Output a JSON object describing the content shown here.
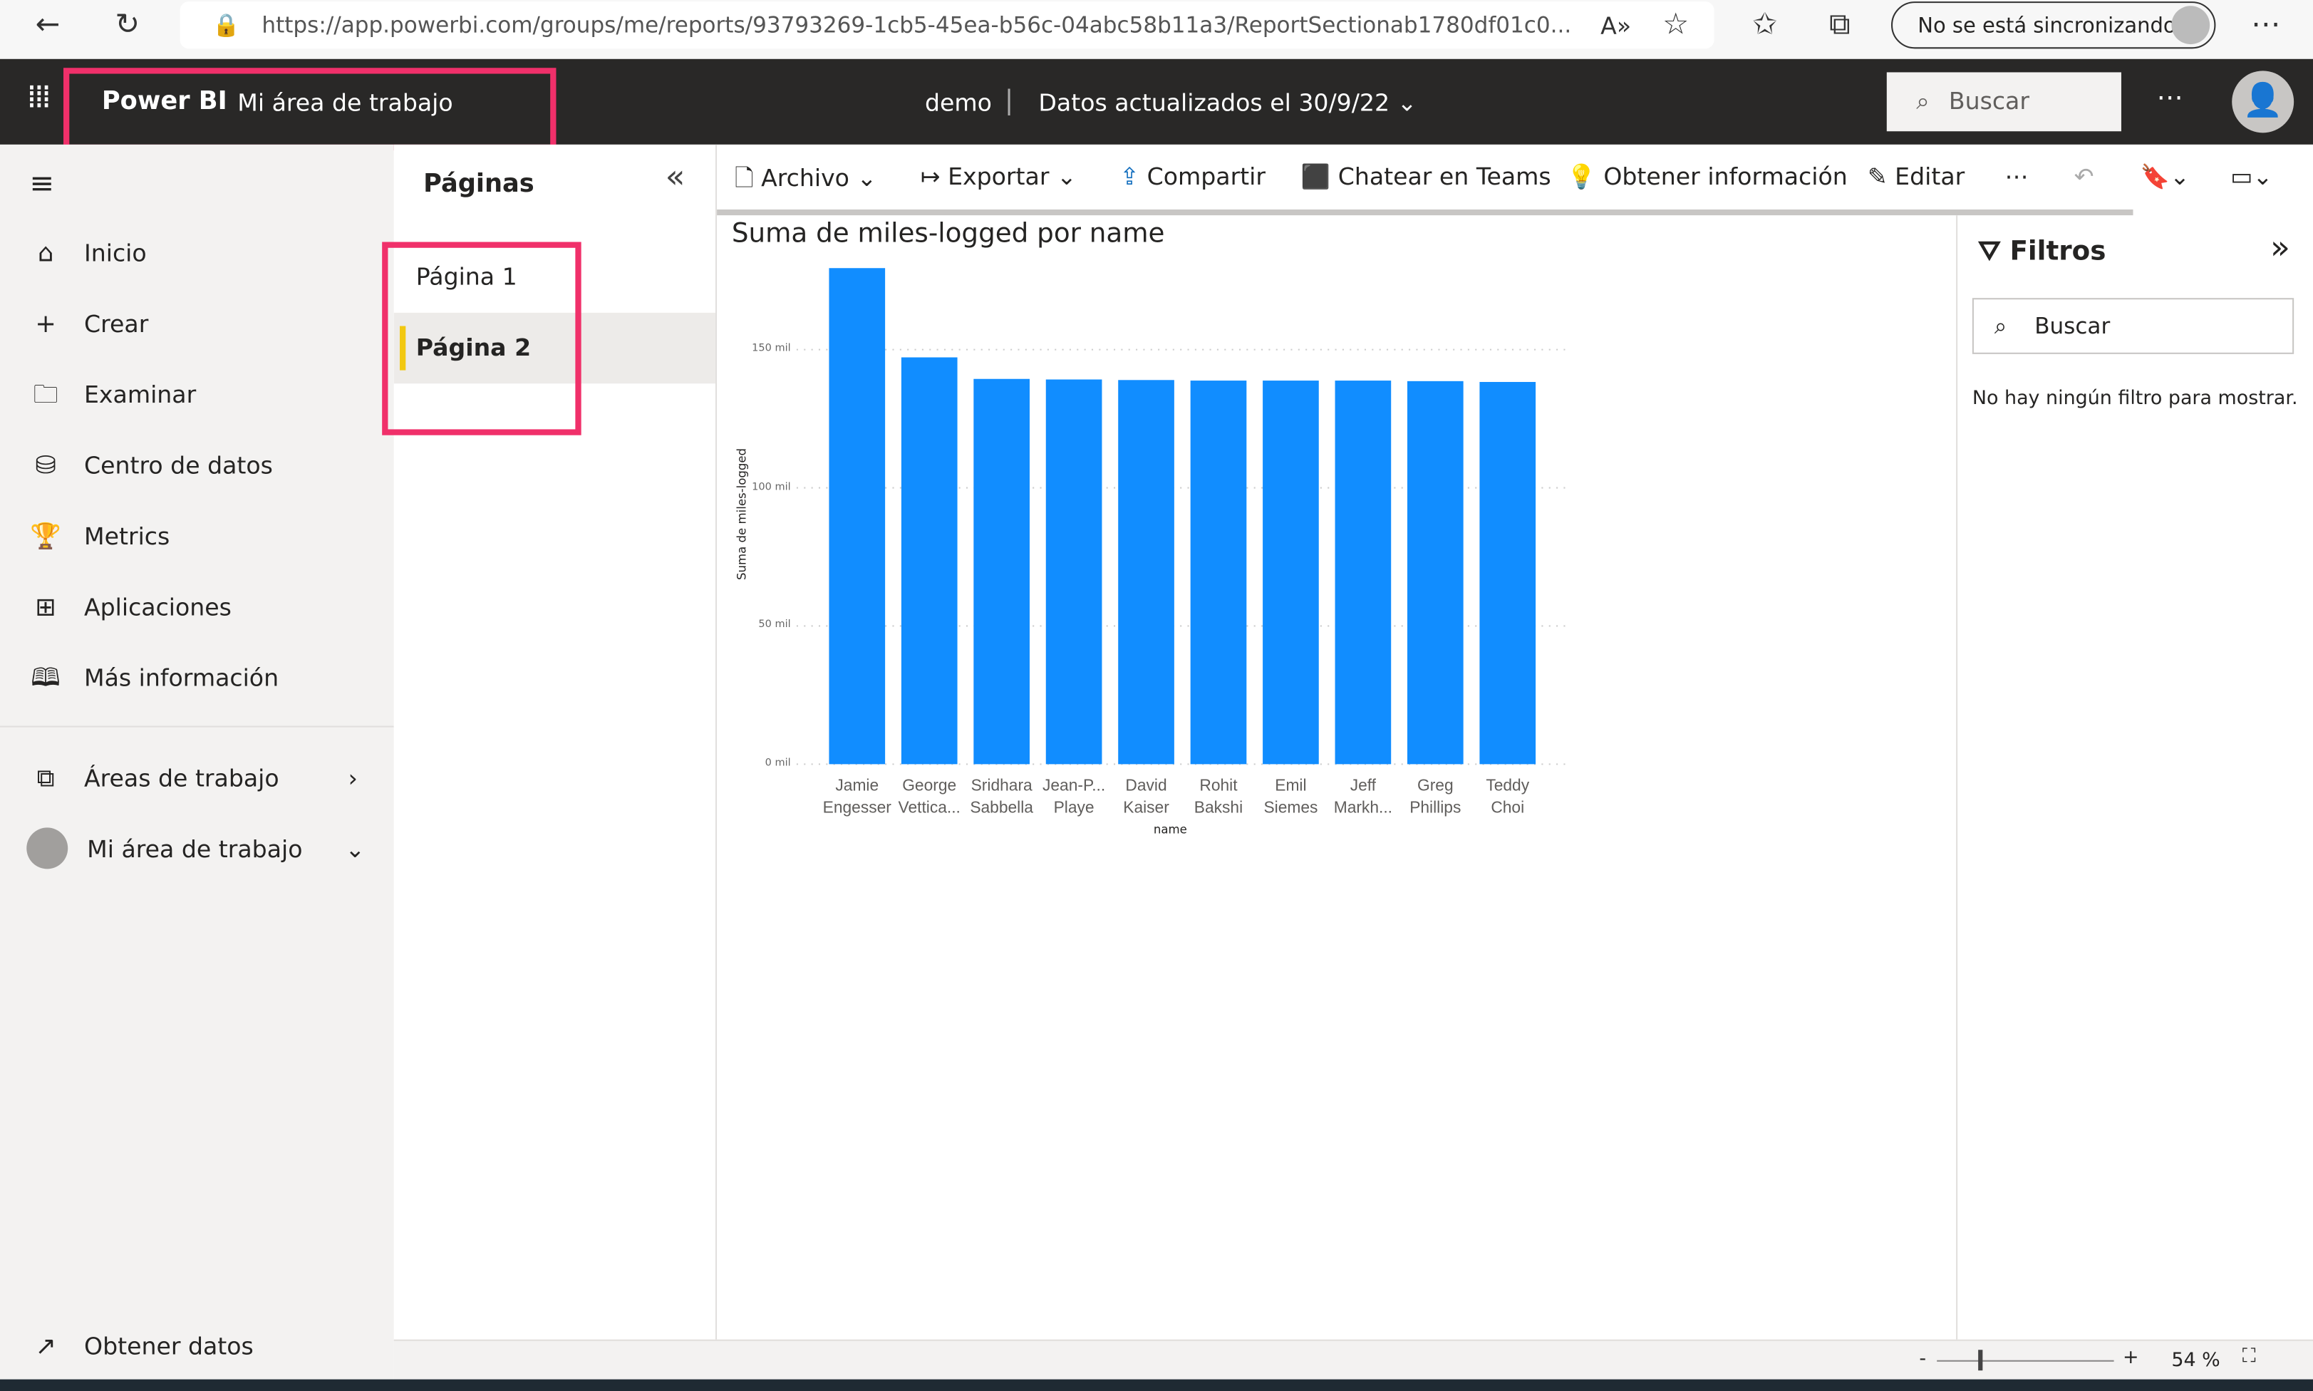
{
  "browser": {
    "url": "https://app.powerbi.com/groups/me/reports/93793269-1cb5-45ea-b56c-04abc58b11a3/ReportSectionab1780df01c0...",
    "sync_label": "No se está sincronizando"
  },
  "header": {
    "brand": "Power BI",
    "workspace": "Mi área de trabajo",
    "report": "demo",
    "updated": "Datos actualizados el 30/9/22",
    "search_placeholder": "Buscar"
  },
  "nav": {
    "items": [
      {
        "icon": "home-icon",
        "label": "Inicio"
      },
      {
        "icon": "plus-icon",
        "label": "Crear"
      },
      {
        "icon": "folder-icon",
        "label": "Examinar"
      },
      {
        "icon": "database-icon",
        "label": "Centro de datos"
      },
      {
        "icon": "trophy-icon",
        "label": "Metrics"
      },
      {
        "icon": "apps-icon",
        "label": "Aplicaciones"
      },
      {
        "icon": "book-icon",
        "label": "Más información"
      }
    ],
    "workspaces": "Áreas de trabajo",
    "my_workspace": "Mi área de trabajo",
    "get_data": "Obtener datos"
  },
  "pages": {
    "title": "Páginas",
    "items": [
      {
        "label": "Página 1",
        "active": false
      },
      {
        "label": "Página 2",
        "active": true
      }
    ]
  },
  "toolbar": {
    "file": "Archivo",
    "export": "Exportar",
    "share": "Compartir",
    "teams": "Chatear en Teams",
    "insights": "Obtener información",
    "edit": "Editar"
  },
  "filters": {
    "title": "Filtros",
    "search_placeholder": "Buscar",
    "empty": "No hay ningún filtro para mostrar."
  },
  "status": {
    "zoom": "54 %",
    "zoom_fraction": 0.54
  },
  "colors": {
    "bar": "#118dff",
    "highlight": "#f0306a",
    "header": "#292827",
    "active_page": "#f2c811"
  },
  "chart_data": {
    "type": "bar",
    "title": "Suma de miles-logged por name",
    "xlabel": "name",
    "ylabel": "Suma de miles-logged",
    "categories": [
      [
        "Jamie",
        "Engesser"
      ],
      [
        "George",
        "Vettica..."
      ],
      [
        "Sridhara",
        "Sabbella"
      ],
      [
        "Jean-P...",
        "Playe"
      ],
      [
        "David",
        "Kaiser"
      ],
      [
        "Rohit",
        "Bakshi"
      ],
      [
        "Emil",
        "Siemes"
      ],
      [
        "Jeff",
        "Markh..."
      ],
      [
        "Greg",
        "Phillips"
      ],
      [
        "Teddy",
        "Choi"
      ]
    ],
    "values": [
      179.5,
      147.2,
      139.4,
      139.2,
      139.0,
      138.8,
      138.8,
      138.8,
      138.6,
      138.3
    ],
    "unit": "mil",
    "yticks": [
      {
        "v": 0,
        "label": "0 mil"
      },
      {
        "v": 50,
        "label": "50 mil"
      },
      {
        "v": 100,
        "label": "100 mil"
      },
      {
        "v": 150,
        "label": "150 mil"
      }
    ],
    "ylim": [
      0,
      180
    ],
    "grid": true,
    "legend": "none"
  }
}
